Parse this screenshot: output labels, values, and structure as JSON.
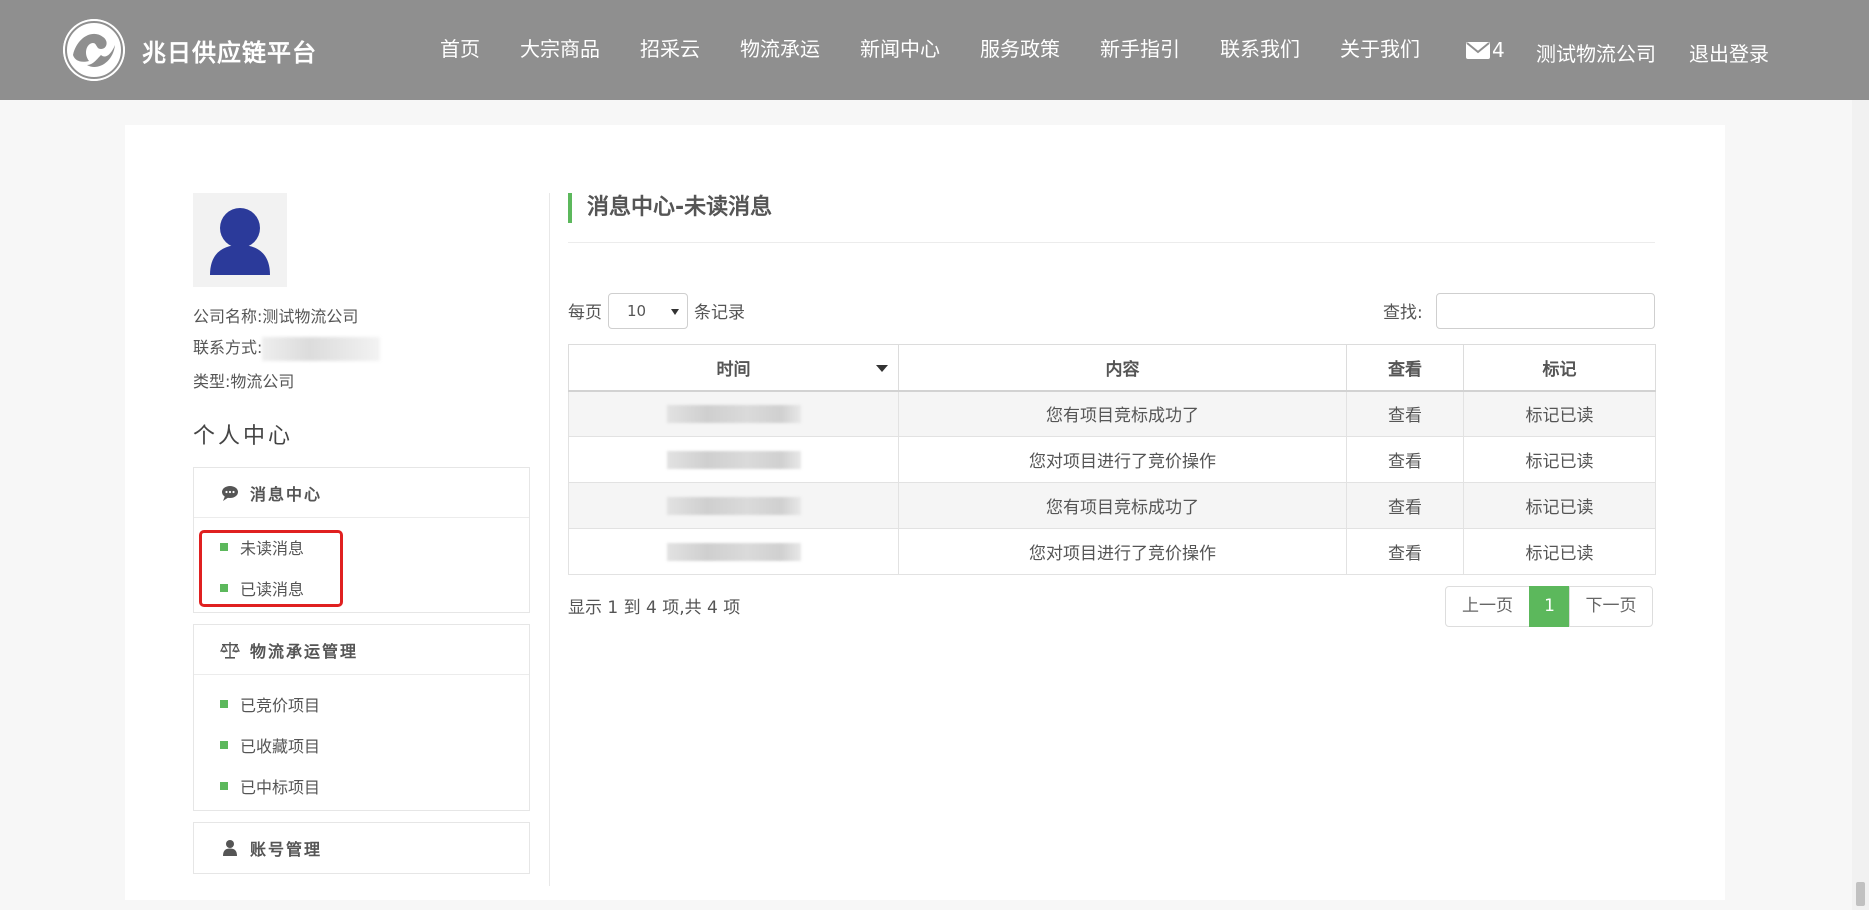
{
  "header": {
    "brand": "兆日供应链平台",
    "nav": [
      "首页",
      "大宗商品",
      "招采云",
      "物流承运",
      "新闻中心",
      "服务政策",
      "新手指引",
      "联系我们",
      "关于我们"
    ],
    "mail_count": "4",
    "company": "测试物流公司",
    "logout": "退出登录"
  },
  "profile": {
    "company_label": "公司名称:",
    "company_value": "测试物流公司",
    "contact_label": "联系方式:",
    "type_label": "类型:",
    "type_value": "物流公司"
  },
  "sidebar": {
    "title": "个人中心",
    "panels": [
      {
        "title": "消息中心",
        "icon": "comment-icon",
        "items": [
          "未读消息",
          "已读消息"
        ]
      },
      {
        "title": "物流承运管理",
        "icon": "balance-scale-icon",
        "items": [
          "已竞价项目",
          "已收藏项目",
          "已中标项目"
        ]
      },
      {
        "title": "账号管理",
        "icon": "user-icon",
        "items": []
      }
    ]
  },
  "content": {
    "title": "消息中心-未读消息",
    "length_prefix": "每页",
    "length_value": "10",
    "length_suffix": "条记录",
    "search_label": "查找:",
    "search_value": "",
    "columns": [
      "时间",
      "内容",
      "查看",
      "标记"
    ],
    "rows": [
      {
        "content": "您有项目竞标成功了",
        "view": "查看",
        "mark": "标记已读"
      },
      {
        "content": "您对项目进行了竞价操作",
        "view": "查看",
        "mark": "标记已读"
      },
      {
        "content": "您有项目竞标成功了",
        "view": "查看",
        "mark": "标记已读"
      },
      {
        "content": "您对项目进行了竞价操作",
        "view": "查看",
        "mark": "标记已读"
      }
    ],
    "info": "显示 1 到 4 项,共 4 项",
    "pagination": {
      "prev": "上一页",
      "current": "1",
      "next": "下一页"
    }
  },
  "colors": {
    "header_bg": "#8f8f8f",
    "accent": "#5cb85c",
    "highlight": "#e02020"
  }
}
